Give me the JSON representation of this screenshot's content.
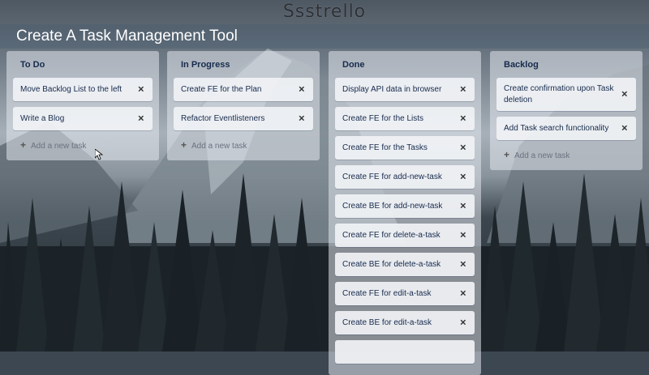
{
  "app": {
    "logo": "Ssstrello"
  },
  "board": {
    "title": "Create A Task Management Tool"
  },
  "lists": [
    {
      "title": "To Do",
      "cards": [
        "Move Backlog List to the left",
        "Write a Blog"
      ],
      "add_label": "Add a new task"
    },
    {
      "title": "In Progress",
      "cards": [
        "Create FE for the Plan",
        "Refactor Eventlisteners"
      ],
      "add_label": "Add a new task"
    },
    {
      "title": "Done",
      "cards": [
        "Display API data in browser",
        "Create FE for the Lists",
        "Create FE for the Tasks",
        "Create FE for add-new-task",
        "Create BE for add-new-task",
        "Create FE for delete-a-task",
        "Create BE for delete-a-task",
        "Create FE for edit-a-task",
        "Create BE for edit-a-task"
      ]
    },
    {
      "title": "Backlog",
      "cards": [
        "Create confirmation upon Task deletion",
        "Add Task search functionality"
      ],
      "add_label": "Add a new task"
    }
  ],
  "icons": {
    "close": "close-icon",
    "add": "plus-icon",
    "cursor": "mouse-pointer-icon"
  }
}
